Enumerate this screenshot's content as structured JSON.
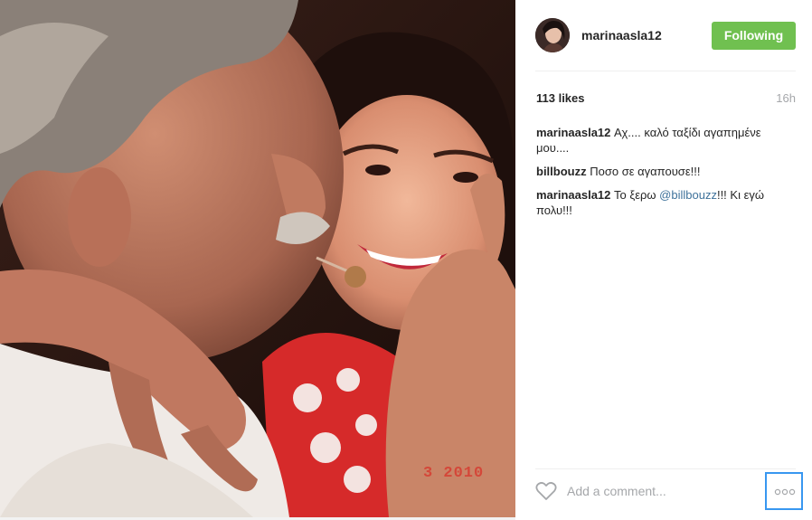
{
  "post": {
    "photo_stamp": "3 2010",
    "user": {
      "username": "marinaasla12",
      "follow_label": "Following"
    },
    "likes": "113 likes",
    "time_ago": "16h",
    "comments": [
      {
        "author": "marinaasla12",
        "text": "Αχ.... καλό ταξίδι αγαπημένε μου....",
        "mention": "",
        "after": ""
      },
      {
        "author": "billbouzz",
        "text": "Ποσο σε αγαπουσε!!!",
        "mention": "",
        "after": ""
      },
      {
        "author": "marinaasla12",
        "text": "Το ξερω",
        "mention": "@billbouzz",
        "after": "!!! Κι εγώ πολυ!!!"
      }
    ],
    "comment_input": {
      "placeholder": "Add a comment..."
    }
  },
  "colors": {
    "follow_button": "#70c050",
    "mention": "#3f729b",
    "focus_border": "#3897f0"
  },
  "icons": {
    "like": "heart-icon",
    "more": "more-options-icon"
  }
}
